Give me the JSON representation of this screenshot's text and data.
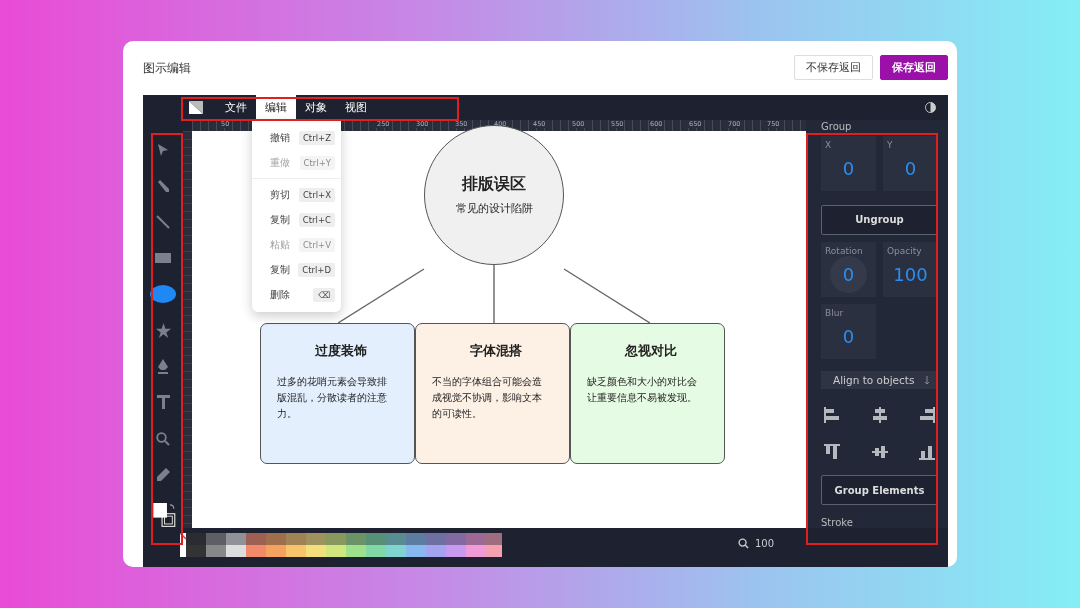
{
  "title": "图示编辑",
  "header_buttons": [
    {
      "label": "不保存返回",
      "kind": "secondary"
    },
    {
      "label": "保存返回",
      "kind": "primary"
    }
  ],
  "menubar": [
    {
      "label": "文件",
      "selected": false
    },
    {
      "label": "编辑",
      "selected": true
    },
    {
      "label": "对象",
      "selected": false
    },
    {
      "label": "视图",
      "selected": false
    }
  ],
  "edit_menu": [
    {
      "kind": "item",
      "label": "撤销",
      "shortcut": "Ctrl+Z",
      "disabled": false
    },
    {
      "kind": "item",
      "label": "重做",
      "shortcut": "Ctrl+Y",
      "disabled": true
    },
    {
      "kind": "separator"
    },
    {
      "kind": "item",
      "label": "剪切",
      "shortcut": "Ctrl+X",
      "disabled": false
    },
    {
      "kind": "item",
      "label": "复制",
      "shortcut": "Ctrl+C",
      "disabled": false
    },
    {
      "kind": "item",
      "label": "粘贴",
      "shortcut": "Ctrl+V",
      "disabled": true
    },
    {
      "kind": "item",
      "label": "复制",
      "shortcut": "Ctrl+D",
      "disabled": false
    },
    {
      "kind": "item",
      "label": "删除",
      "shortcut": "⌫",
      "disabled": false
    }
  ],
  "ruler_labels": [
    "50",
    "250",
    "300",
    "350",
    "400",
    "450",
    "500",
    "550",
    "600",
    "650",
    "700",
    "750"
  ],
  "tools": [
    {
      "kind": "select",
      "selected": false
    },
    {
      "kind": "pencil",
      "selected": false
    },
    {
      "kind": "line",
      "selected": false
    },
    {
      "kind": "rect",
      "selected": false
    },
    {
      "kind": "ellipse",
      "selected": true
    },
    {
      "kind": "star",
      "selected": false
    },
    {
      "kind": "pen",
      "selected": false
    },
    {
      "kind": "text",
      "selected": false
    },
    {
      "kind": "zoom",
      "selected": false
    },
    {
      "kind": "eyedropper",
      "selected": false
    }
  ],
  "diagram": {
    "center": {
      "title": "排版误区",
      "subtitle": "常见的设计陷阱"
    },
    "cards": [
      {
        "title": "过度装饰",
        "text": "过多的花哨元素会导致排版混乱，分散读者的注意力。",
        "color": "#e3effd"
      },
      {
        "title": "字体混搭",
        "text": "不当的字体组合可能会造成视觉不协调，影响文本的可读性。",
        "color": "#fdf1e6"
      },
      {
        "title": "忽视对比",
        "text": "缺乏颜色和大小的对比会让重要信息不易被发现。",
        "color": "#e6fbe4"
      }
    ]
  },
  "properties": {
    "section": "Group",
    "position_fields": [
      {
        "label": "X",
        "value": "0"
      },
      {
        "label": "Y",
        "value": "0"
      }
    ],
    "ungroup_button": "Ungroup",
    "transform_fields": [
      {
        "kind": "dial",
        "label": "Rotation",
        "value": "0"
      },
      {
        "kind": "number",
        "label": "Opacity",
        "value": "100"
      },
      {
        "kind": "number",
        "label": "Blur",
        "value": "0"
      }
    ],
    "align_select": "Align to objects",
    "align_buttons": [
      {
        "kind": "left"
      },
      {
        "kind": "center"
      },
      {
        "kind": "right"
      },
      {
        "kind": "top"
      },
      {
        "kind": "middle"
      },
      {
        "kind": "bottom"
      }
    ],
    "group_button": "Group Elements",
    "next_section": "Stroke"
  },
  "zoom": "100"
}
